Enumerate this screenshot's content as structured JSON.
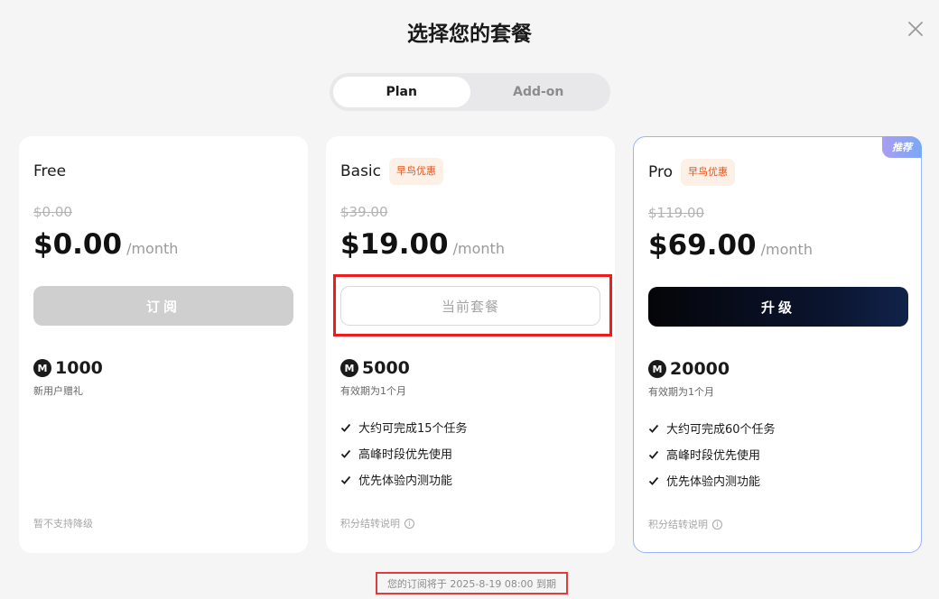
{
  "dialog": {
    "title": "选择您的套餐",
    "expiry_notice": "您的订阅将于 2025-8-19 08:00 到期"
  },
  "tabs": [
    {
      "label": "Plan",
      "active": true
    },
    {
      "label": "Add-on",
      "active": false
    }
  ],
  "plans": [
    {
      "name": "Free",
      "old_price": "$0.00",
      "price": "$0.00",
      "unit": "/month",
      "button": "订阅",
      "credits": "1000",
      "credit_note": "新用户赠礼",
      "footer": "暂不支持降级"
    },
    {
      "name": "Basic",
      "promo": "早鸟优惠",
      "old_price": "$39.00",
      "price": "$19.00",
      "unit": "/month",
      "button": "当前套餐",
      "credits": "5000",
      "credit_note": "有效期为1个月",
      "features": [
        "大约可完成15个任务",
        "高峰时段优先使用",
        "优先体验内测功能"
      ],
      "footer": "积分结转说明"
    },
    {
      "name": "Pro",
      "badge": "推荐",
      "promo": "早鸟优惠",
      "old_price": "$119.00",
      "price": "$69.00",
      "unit": "/month",
      "button": "升级",
      "credits": "20000",
      "credit_note": "有效期为1个月",
      "features": [
        "大约可完成60个任务",
        "高峰时段优先使用",
        "优先体验内测功能"
      ],
      "footer": "积分结转说明"
    }
  ],
  "icons": {
    "coin_glyph": "M",
    "info_glyph": "i"
  },
  "colors": {
    "promo_text": "#e8541c",
    "promo_bg": "#fdf0e6",
    "pro_border": "#9ab4f5",
    "highlight": "#ee1c1c"
  }
}
